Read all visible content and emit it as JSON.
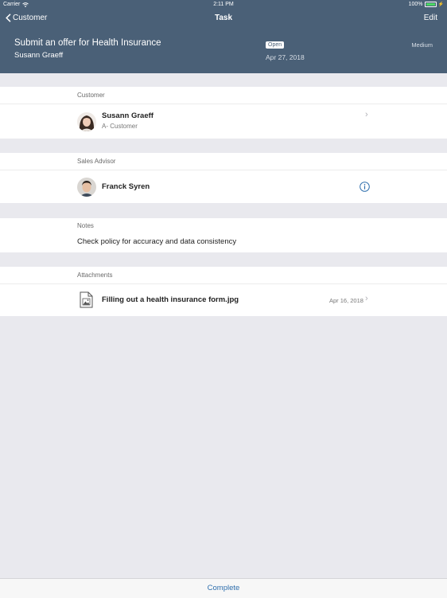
{
  "status_bar": {
    "carrier": "Carrier",
    "time": "2:11 PM",
    "battery": "100%"
  },
  "nav": {
    "back_label": "Customer",
    "title": "Task",
    "edit_label": "Edit"
  },
  "task": {
    "title": "Submit an offer for Health Insurance",
    "customer_name": "Susann Graeff",
    "status": "Open",
    "date": "Apr 27, 2018",
    "priority": "Medium"
  },
  "customer_section": {
    "label": "Customer",
    "name": "Susann Graeff",
    "type": "A- Customer"
  },
  "advisor_section": {
    "label": "Sales Advisor",
    "name": "Franck Syren"
  },
  "notes_section": {
    "label": "Notes",
    "text": "Check policy for accuracy and data consistency"
  },
  "attachments_section": {
    "label": "Attachments",
    "file_name": "Filling out a health insurance form.jpg",
    "file_date": "Apr 16, 2018"
  },
  "bottom": {
    "complete_label": "Complete"
  },
  "colors": {
    "header": "#4a6077",
    "accent": "#2f6fad",
    "background": "#e9e9ee"
  }
}
